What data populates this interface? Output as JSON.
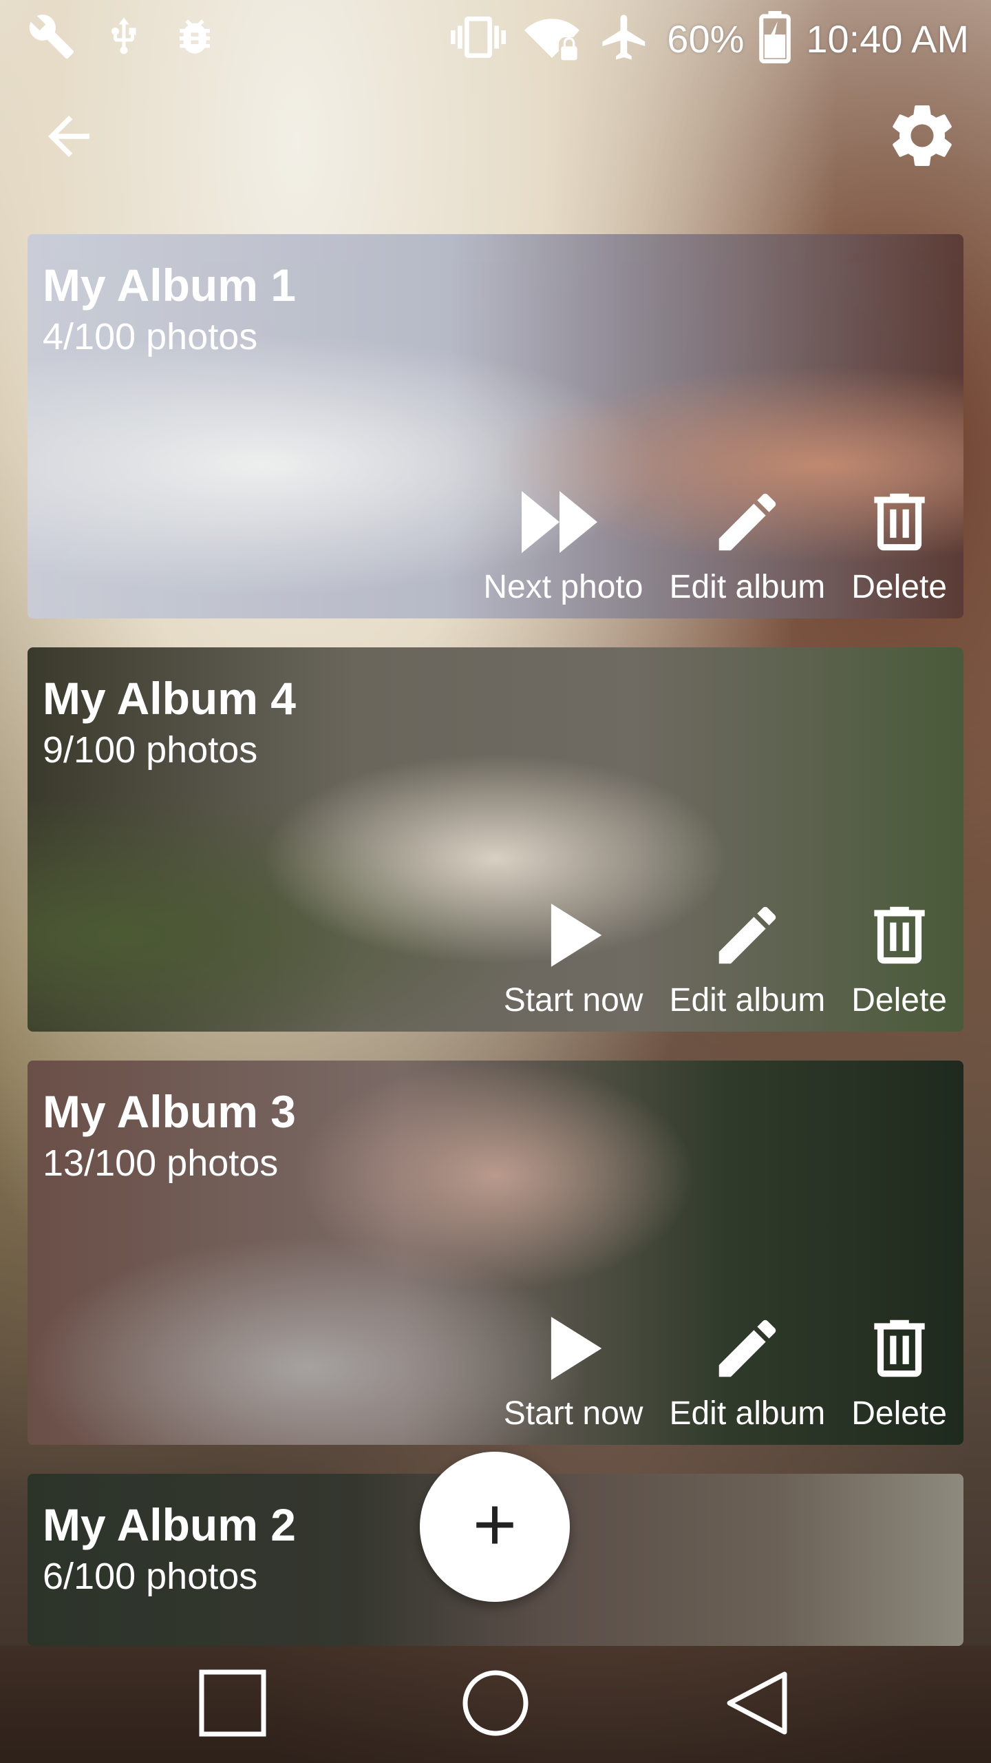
{
  "status_bar": {
    "battery_percent": "60%",
    "time": "10:40 AM",
    "icons_left": [
      "wrench-icon",
      "usb-icon",
      "bug-icon"
    ],
    "icons_right": [
      "vibrate-icon",
      "wifi-lock-icon",
      "airplane-icon",
      "battery-charging-icon"
    ]
  },
  "app_bar": {
    "back_icon": "arrow-left-icon",
    "settings_icon": "gear-icon"
  },
  "albums": [
    {
      "title": "My Album 1",
      "subtitle": "4/100 photos",
      "actions": [
        {
          "label": "Next photo",
          "icon": "fast-forward-icon"
        },
        {
          "label": "Edit album",
          "icon": "pencil-icon"
        },
        {
          "label": "Delete",
          "icon": "trash-icon"
        }
      ]
    },
    {
      "title": "My Album 4",
      "subtitle": "9/100 photos",
      "actions": [
        {
          "label": "Start now",
          "icon": "play-icon"
        },
        {
          "label": "Edit album",
          "icon": "pencil-icon"
        },
        {
          "label": "Delete",
          "icon": "trash-icon"
        }
      ]
    },
    {
      "title": "My Album 3",
      "subtitle": "13/100 photos",
      "actions": [
        {
          "label": "Start now",
          "icon": "play-icon"
        },
        {
          "label": "Edit album",
          "icon": "pencil-icon"
        },
        {
          "label": "Delete",
          "icon": "trash-icon"
        }
      ]
    },
    {
      "title": "My Album 2",
      "subtitle": "6/100 photos"
    }
  ],
  "fab": {
    "label": "+"
  },
  "nav_bar": {
    "recents_icon": "square-icon",
    "home_icon": "circle-icon",
    "back_icon": "triangle-back-icon"
  }
}
